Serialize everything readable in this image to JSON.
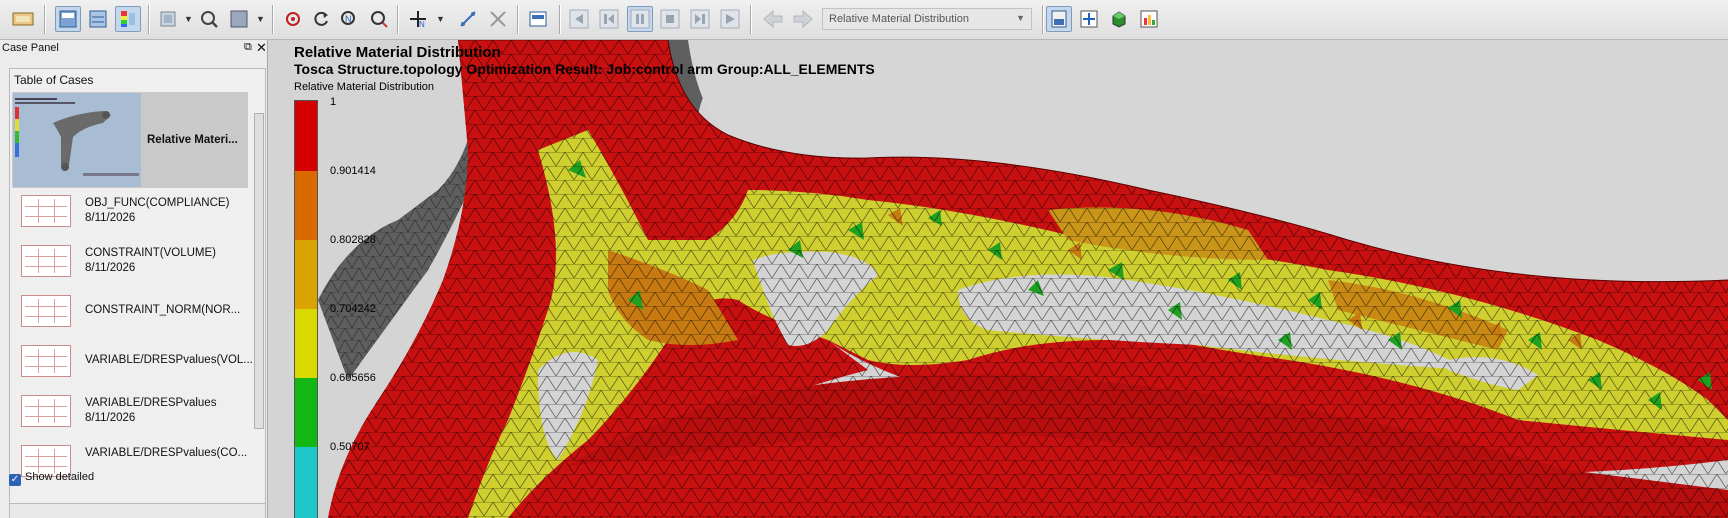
{
  "toolbar": {
    "result_select": "Relative Material Distribution",
    "result_select_arrow": "▼"
  },
  "case_panel": {
    "title": "Case Panel",
    "float_glyph": "⧉",
    "close_glyph": "✕",
    "table_title": "Table of Cases",
    "cases": [
      {
        "name": "Relative Materi...",
        "date": ""
      },
      {
        "name": "OBJ_FUNC(COMPLIANCE)",
        "date": "8/11/2026"
      },
      {
        "name": "CONSTRAINT(VOLUME)",
        "date": "8/11/2026"
      },
      {
        "name": "CONSTRAINT_NORM(NOR...",
        "date": ""
      },
      {
        "name": "VARIABLE/DRESPvalues(VOL...",
        "date": ""
      },
      {
        "name": "VARIABLE/DRESPvalues",
        "date": "8/11/2026"
      },
      {
        "name": "VARIABLE/DRESPvalues(CO...",
        "date": ""
      }
    ],
    "show_detailed": {
      "label": "Show detailed",
      "checked": true,
      "check_glyph": "✓"
    }
  },
  "viewport": {
    "title": "Relative Material Distribution",
    "subtitle": "Tosca Structure.topology Optimization Result: Job:control arm Group:ALL_ELEMENTS",
    "legend": {
      "title": "Relative Material Distribution",
      "labels": [
        "1",
        "0.901414",
        "0.802828",
        "0.704242",
        "0.605656",
        "0.50707"
      ],
      "colors": [
        "#d40000",
        "#d86a00",
        "#d9a300",
        "#d9d900",
        "#13b713",
        "#1ec8c8"
      ]
    }
  },
  "colors": {
    "mesh_red": "#c81010",
    "mesh_orange": "#c77a12",
    "mesh_yellow": "#cfcf30",
    "mesh_green": "#20a020",
    "mesh_gray": "#5e5e5e",
    "toolbar_active": "#c5d7ec"
  }
}
